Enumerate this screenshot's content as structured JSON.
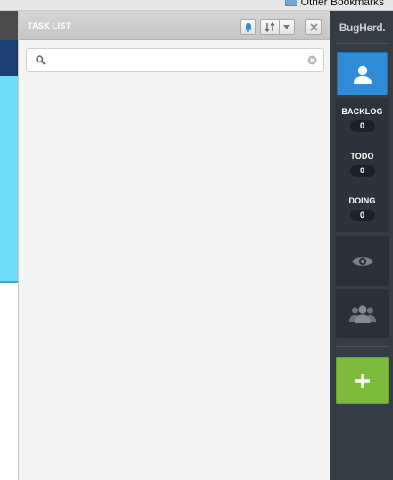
{
  "browser": {
    "bookmarks_label": "Other Bookmarks"
  },
  "task_panel": {
    "title": "TASK LIST",
    "search": {
      "value": "",
      "placeholder": ""
    },
    "icons": {
      "bell": "bell-icon",
      "sort": "sort-icon",
      "dropdown": "chevron-down-icon",
      "close": "close-icon",
      "search": "search-icon",
      "clear": "clear-icon"
    }
  },
  "sidebar": {
    "brand": "BugHerd.",
    "stats": [
      {
        "label": "BACKLOG",
        "count": "0"
      },
      {
        "label": "TODO",
        "count": "0"
      },
      {
        "label": "DOING",
        "count": "0"
      }
    ],
    "tools": [
      "user-icon",
      "eye-icon",
      "team-icon",
      "plus-icon"
    ]
  },
  "colors": {
    "accent_blue": "#2f8bd6",
    "add_green": "#7dbb3c",
    "sidebar_bg": "#343c46",
    "page_hero": "#6fdcfb"
  }
}
